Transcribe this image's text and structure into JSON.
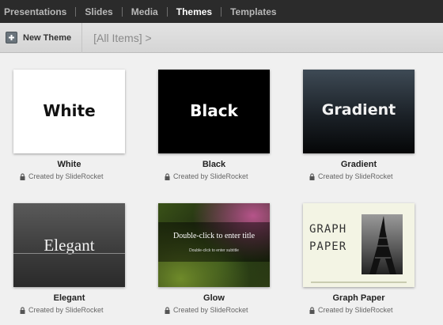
{
  "nav": {
    "items": [
      "Presentations",
      "Slides",
      "Media",
      "Themes",
      "Templates"
    ],
    "active": "Themes"
  },
  "toolbar": {
    "new_theme_label": "New Theme",
    "new_theme_icon": "plus-icon",
    "breadcrumb": "[All Items] >"
  },
  "themes": [
    {
      "name": "White",
      "thumb_text": "White",
      "creator": "Created by SlideRocket"
    },
    {
      "name": "Black",
      "thumb_text": "Black",
      "creator": "Created by SlideRocket"
    },
    {
      "name": "Gradient",
      "thumb_text": "Gradient",
      "creator": "Created by SlideRocket"
    },
    {
      "name": "Elegant",
      "thumb_text": "Elegant",
      "creator": "Created by SlideRocket"
    },
    {
      "name": "Glow",
      "thumb_text": "Double-click to enter title",
      "thumb_subtext": "Double-click to enter subtitle",
      "creator": "Created by SlideRocket"
    },
    {
      "name": "Graph Paper",
      "thumb_text": "GRAPH PAPER",
      "creator": "Created by SlideRocket"
    }
  ],
  "colors": {
    "nav_bg": "#2b2b2b",
    "nav_active": "#ffffff",
    "nav_inactive": "#b8b8b8",
    "page_bg": "#f0f0f0"
  }
}
